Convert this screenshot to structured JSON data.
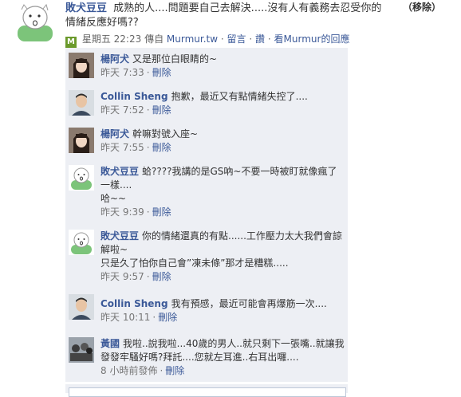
{
  "post": {
    "author": "敗犬豆豆",
    "text": "成熟的人....問題要自己去解決.....沒有人有義務去忍受你的情緒反應好嗎??",
    "remove_label": "（移除）",
    "meta": {
      "icon": "M",
      "datetime": "星期五 22:23",
      "via": "傳自",
      "source": "Murmur.tw",
      "comment_label": "留言",
      "like_label": "讚",
      "view_label": "看Murmur的回應",
      "sep": "·"
    }
  },
  "comments": [
    {
      "author": "楊阿犬",
      "text": "又是那位白眼睛的~",
      "time": "昨天 7:33",
      "delete": "刪除",
      "avatar": "girl-photo"
    },
    {
      "author": "Collin Sheng",
      "text": "抱歉，最近又有點情緒失控了....",
      "time": "昨天 7:52",
      "delete": "刪除",
      "avatar": "man-photo"
    },
    {
      "author": "楊阿犬",
      "text": "幹嘛對號入座~",
      "time": "昨天 7:55",
      "delete": "刪除",
      "avatar": "girl-photo"
    },
    {
      "author": "敗犬豆豆",
      "text": "蛤????我講的是GS吶~不要一時被盯就像瘋了一樣....\n哈~~",
      "time": "昨天 9:39",
      "delete": "刪除",
      "avatar": "cartoon"
    },
    {
      "author": "敗犬豆豆",
      "text": "你的情緒還真的有點......工作壓力太大我們會諒解啦~\n只是久了怕你自己會”凍未條”那才是糟糕.....",
      "time": "昨天 9:57",
      "delete": "刪除",
      "avatar": "cartoon"
    },
    {
      "author": "Collin Sheng",
      "text": "我有預感，最近可能會再爆筋一次....",
      "time": "昨天 10:11",
      "delete": "刪除",
      "avatar": "man-photo"
    },
    {
      "author": "黃國",
      "text": "我啦..說我啦...40歲的男人..就只剩下一張嘴..就讓我發發牢騷好嗎?拜託....您就左耳進..右耳出囉....",
      "time": "8 小時前發佈",
      "delete": "刪除",
      "avatar": "group-photo"
    }
  ],
  "colors": {
    "link": "#3b5998",
    "comment_bg": "#edeff4",
    "meta_icon": "#6b9a2c"
  }
}
